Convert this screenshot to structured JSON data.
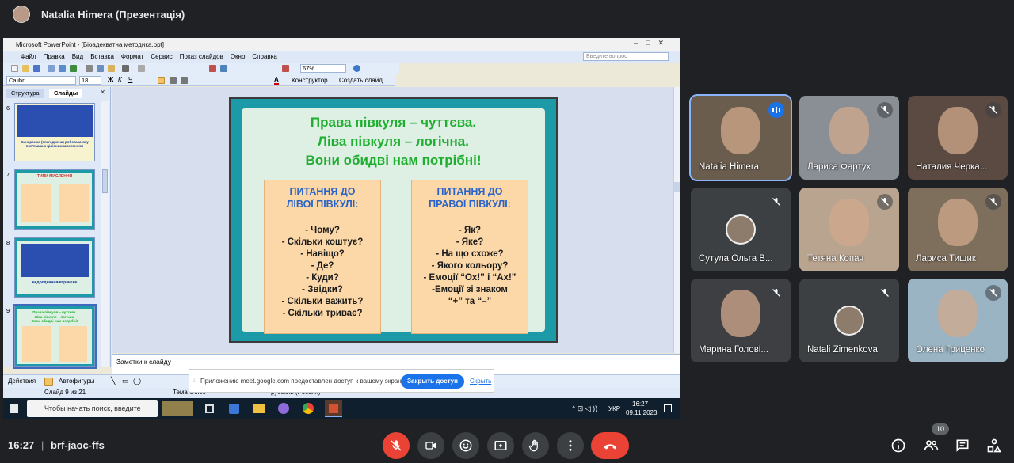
{
  "meeting": {
    "presenter_title": "Natalia Himera (Презентація)",
    "clock": "16:27",
    "code": "brf-jaoc-ffs",
    "participant_badge": "10"
  },
  "powerpoint": {
    "window_title": "Microsoft PowerPoint - [Біоадекватна методика.ppt]",
    "menu": [
      "Файл",
      "Правка",
      "Вид",
      "Вставка",
      "Формат",
      "Сервис",
      "Показ слайдов",
      "Окно",
      "Справка"
    ],
    "help_placeholder": "Введите вопрос",
    "zoom": "67%",
    "font_name": "Calibri",
    "font_size": "18",
    "designer_label": "Конструктор",
    "new_slide_label": "Создать слайд",
    "tab_outline": "Структура",
    "tab_slides": "Слайды",
    "thumb_numbers": [
      "6",
      "7",
      "8",
      "9"
    ],
    "thumb6_caption": "Синхронна (злагоджена) робота мозку пов'язана з цілісним мисленням",
    "thumb7_title": "ТИПИ МИСЛЕННЯ",
    "thumb8_caption": "недоєднання/втрачене",
    "notes_placeholder": "Заметки к слайду",
    "actions_label": "Действия",
    "autoshapes_label": "Автофигуры",
    "status_slide": "Слайд 9 из 21",
    "status_theme": "Тема Office",
    "status_lang": "русский (Россия)"
  },
  "slide": {
    "headline": [
      "Права півкуля – чуттєва.",
      "Ліва півкуля – логічна.",
      "Вони обидві нам потрібні!"
    ],
    "left_header": [
      "ПИТАННЯ ДО",
      "ЛІВОЇ ПІВКУЛІ:"
    ],
    "left_items": [
      "- Чому?",
      "- Скільки коштує?",
      "- Навіщо?",
      "- Де?",
      "- Куди?",
      "- Звідки?",
      "- Скільки важить?",
      "- Скільки триває?"
    ],
    "right_header": [
      "ПИТАННЯ ДО",
      "ПРАВОЇ ПІВКУЛІ:"
    ],
    "right_items": [
      "- Як?",
      "- Яке?",
      "- На що схоже?",
      "- Якого кольору?",
      "- Емоції “Ох!” і “Ах!”",
      "-Емоції зі знаком",
      "“+” та “–”"
    ]
  },
  "notification": {
    "text": "Приложению meet.google.com предоставлен доступ к вашему экрану.",
    "stop_label": "Закрыть доступ",
    "hide_label": "Скрыть"
  },
  "windows": {
    "search_placeholder": "Чтобы начать поиск, введите",
    "lang": "УКР",
    "time": "16:27",
    "date": "09.11.2023"
  },
  "participants": [
    {
      "name": "Natalia Himera",
      "bg": "#6a5d4e"
    },
    {
      "name": "Лариса Фартух",
      "bg": "#8a8f96"
    },
    {
      "name": "Наталия Черка...",
      "bg": "#5a4a42"
    },
    {
      "name": "Сутула Ольга В...",
      "bg": "#3c4043"
    },
    {
      "name": "Тетяна Копач",
      "bg": "#b9a48f"
    },
    {
      "name": "Лариса Тищик",
      "bg": "#7e6e5c"
    },
    {
      "name": "Марина Голові...",
      "bg": "#3d3f43"
    },
    {
      "name": "Natali Zimenkova",
      "bg": "#3c4043"
    },
    {
      "name": "Олена Гриценко",
      "bg": "#9ab4c4"
    }
  ]
}
